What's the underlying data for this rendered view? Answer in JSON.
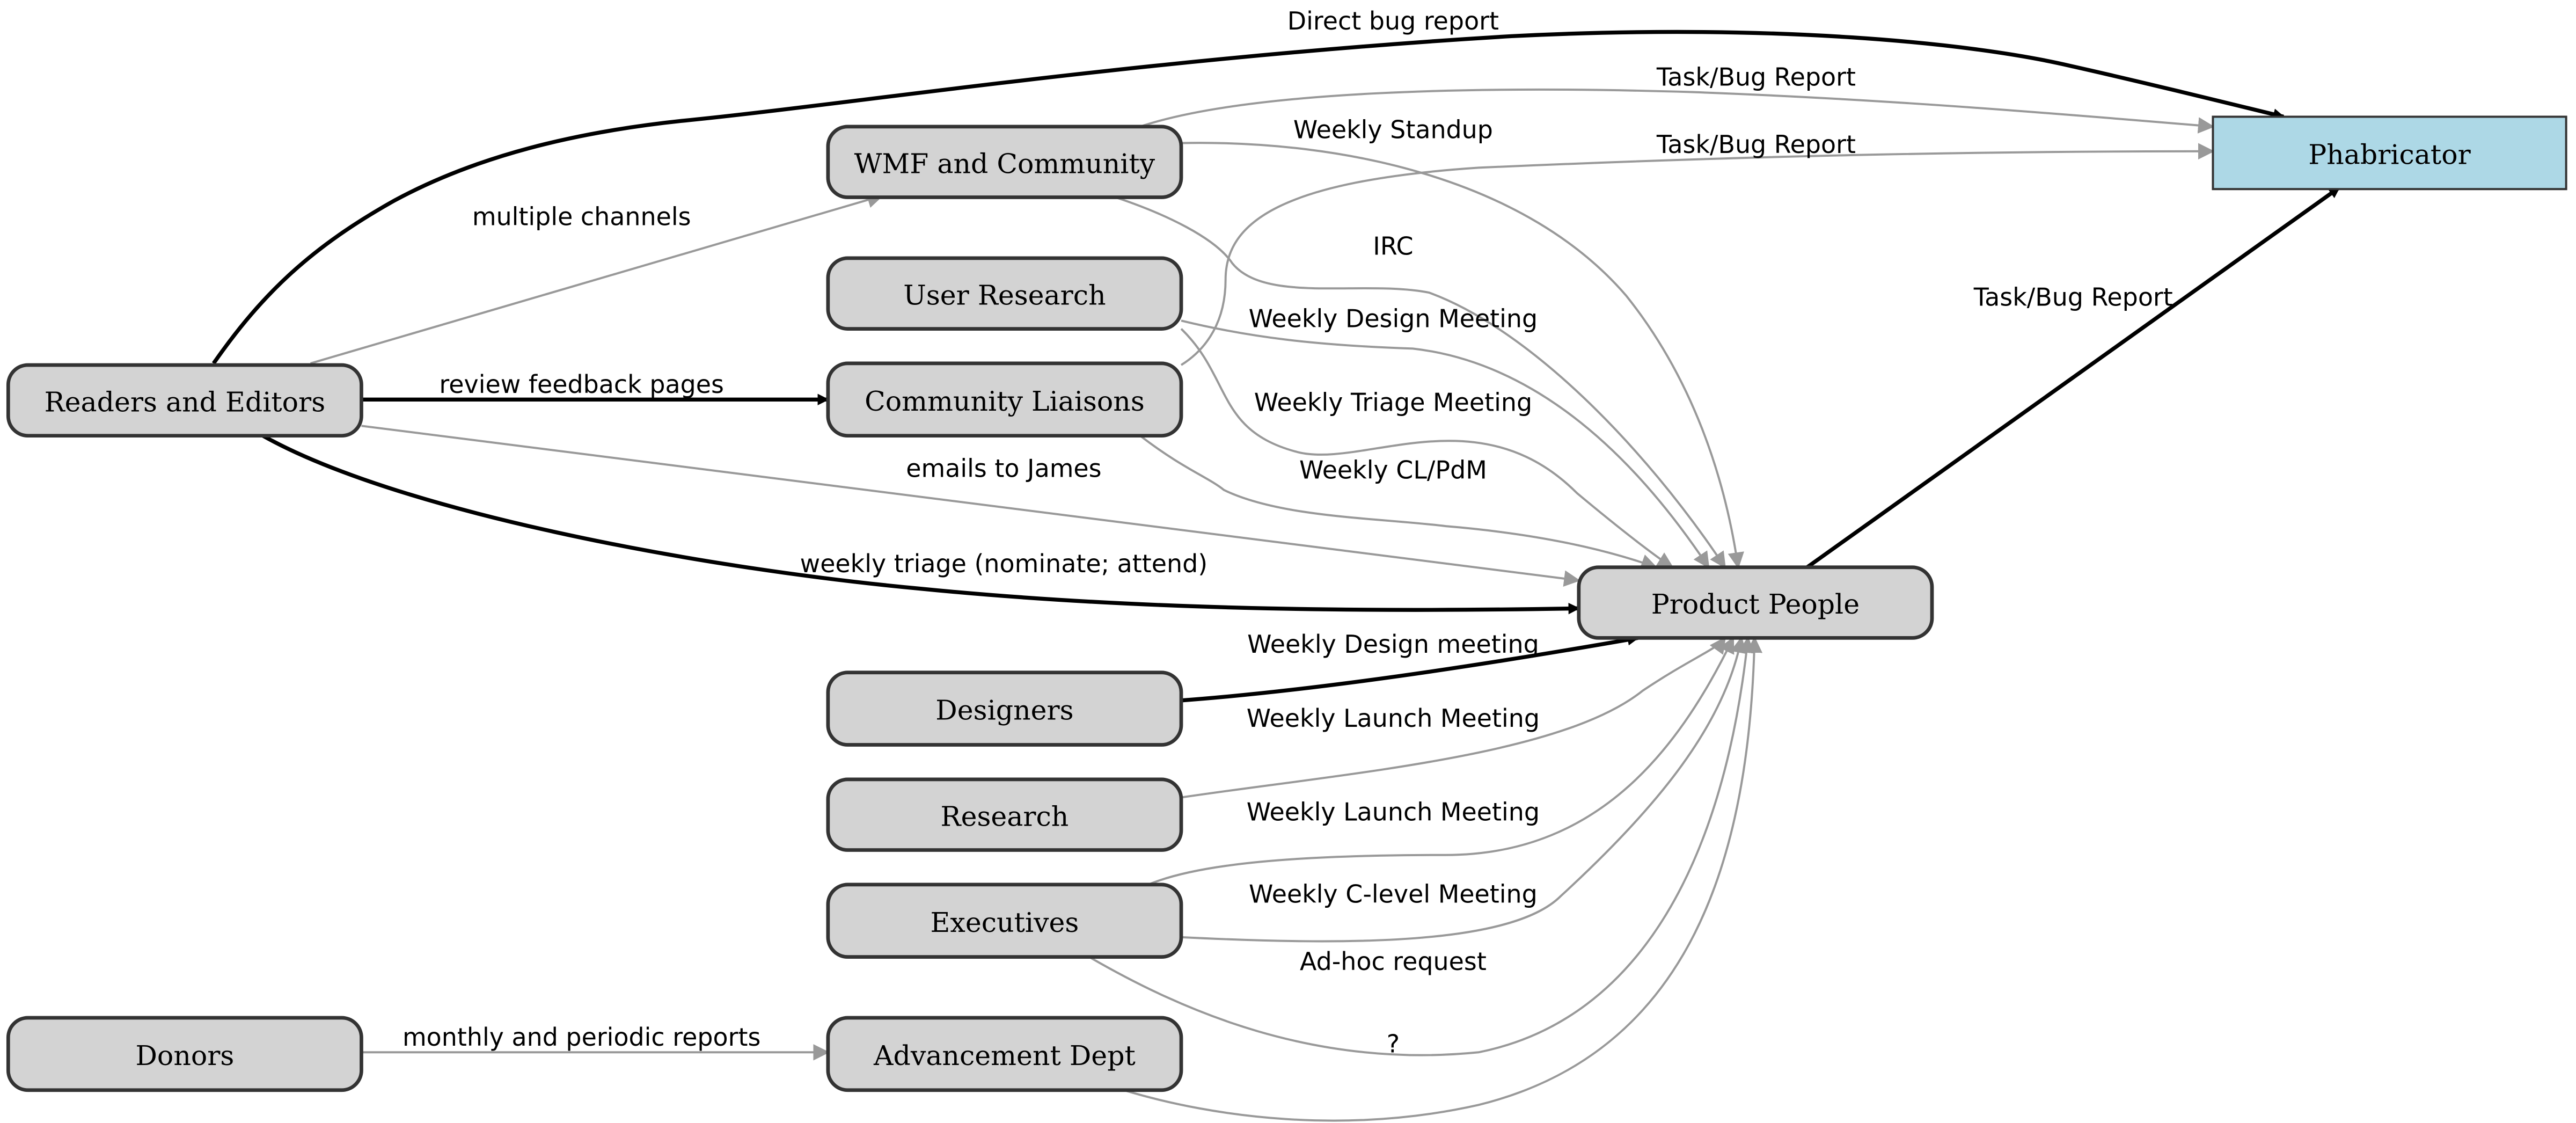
{
  "diagram": {
    "type": "directed-graph",
    "colors": {
      "node_fill": "#d3d3d3",
      "node_border": "#333333",
      "target_fill": "#add8e6",
      "strong_edge": "#000000",
      "weak_edge": "#999999"
    },
    "nodes": [
      {
        "id": "readers",
        "label": "Readers and Editors",
        "shape": "rounded"
      },
      {
        "id": "wmf",
        "label": "WMF and Community",
        "shape": "rounded"
      },
      {
        "id": "userresearch",
        "label": "User Research",
        "shape": "rounded"
      },
      {
        "id": "liaisons",
        "label": "Community Liaisons",
        "shape": "rounded"
      },
      {
        "id": "designers",
        "label": "Designers",
        "shape": "rounded"
      },
      {
        "id": "research",
        "label": "Research",
        "shape": "rounded"
      },
      {
        "id": "executives",
        "label": "Executives",
        "shape": "rounded"
      },
      {
        "id": "donors",
        "label": "Donors",
        "shape": "rounded"
      },
      {
        "id": "advancement",
        "label": "Advancement Dept",
        "shape": "rounded"
      },
      {
        "id": "product",
        "label": "Product People",
        "shape": "rounded"
      },
      {
        "id": "phabricator",
        "label": "Phabricator",
        "shape": "box",
        "highlight": true
      }
    ],
    "edges": [
      {
        "from": "readers",
        "to": "phabricator",
        "label": "Direct bug report",
        "style": "strong"
      },
      {
        "from": "wmf",
        "to": "phabricator",
        "label": "Task/Bug Report",
        "style": "weak"
      },
      {
        "from": "liaisons",
        "to": "phabricator",
        "label": "Task/Bug Report",
        "style": "weak"
      },
      {
        "from": "product",
        "to": "phabricator",
        "label": "Task/Bug Report",
        "style": "strong"
      },
      {
        "from": "readers",
        "to": "wmf",
        "label": "multiple channels",
        "style": "weak"
      },
      {
        "from": "readers",
        "to": "liaisons",
        "label": "review feedback pages",
        "style": "strong"
      },
      {
        "from": "readers",
        "to": "product",
        "label": "emails to James",
        "style": "weak"
      },
      {
        "from": "readers",
        "to": "product",
        "label": "weekly triage (nominate; attend)",
        "style": "strong"
      },
      {
        "from": "wmf",
        "to": "product",
        "label": "Weekly Standup",
        "style": "weak"
      },
      {
        "from": "wmf",
        "to": "product",
        "label": "IRC",
        "style": "weak"
      },
      {
        "from": "userresearch",
        "to": "product",
        "label": "Weekly Design Meeting",
        "style": "weak"
      },
      {
        "from": "userresearch",
        "to": "product",
        "label": "Weekly Triage Meeting",
        "style": "weak"
      },
      {
        "from": "liaisons",
        "to": "product",
        "label": "Weekly CL/PdM",
        "style": "weak"
      },
      {
        "from": "designers",
        "to": "product",
        "label": "Weekly Design meeting",
        "style": "strong"
      },
      {
        "from": "research",
        "to": "product",
        "label": "Weekly Launch Meeting",
        "style": "weak"
      },
      {
        "from": "executives",
        "to": "product",
        "label": "Weekly Launch Meeting",
        "style": "weak"
      },
      {
        "from": "executives",
        "to": "product",
        "label": "Weekly C-level Meeting",
        "style": "weak"
      },
      {
        "from": "executives",
        "to": "product",
        "label": "Ad-hoc request",
        "style": "weak"
      },
      {
        "from": "advancement",
        "to": "product",
        "label": "?",
        "style": "weak"
      },
      {
        "from": "donors",
        "to": "advancement",
        "label": "monthly and periodic reports",
        "style": "weak"
      }
    ]
  }
}
